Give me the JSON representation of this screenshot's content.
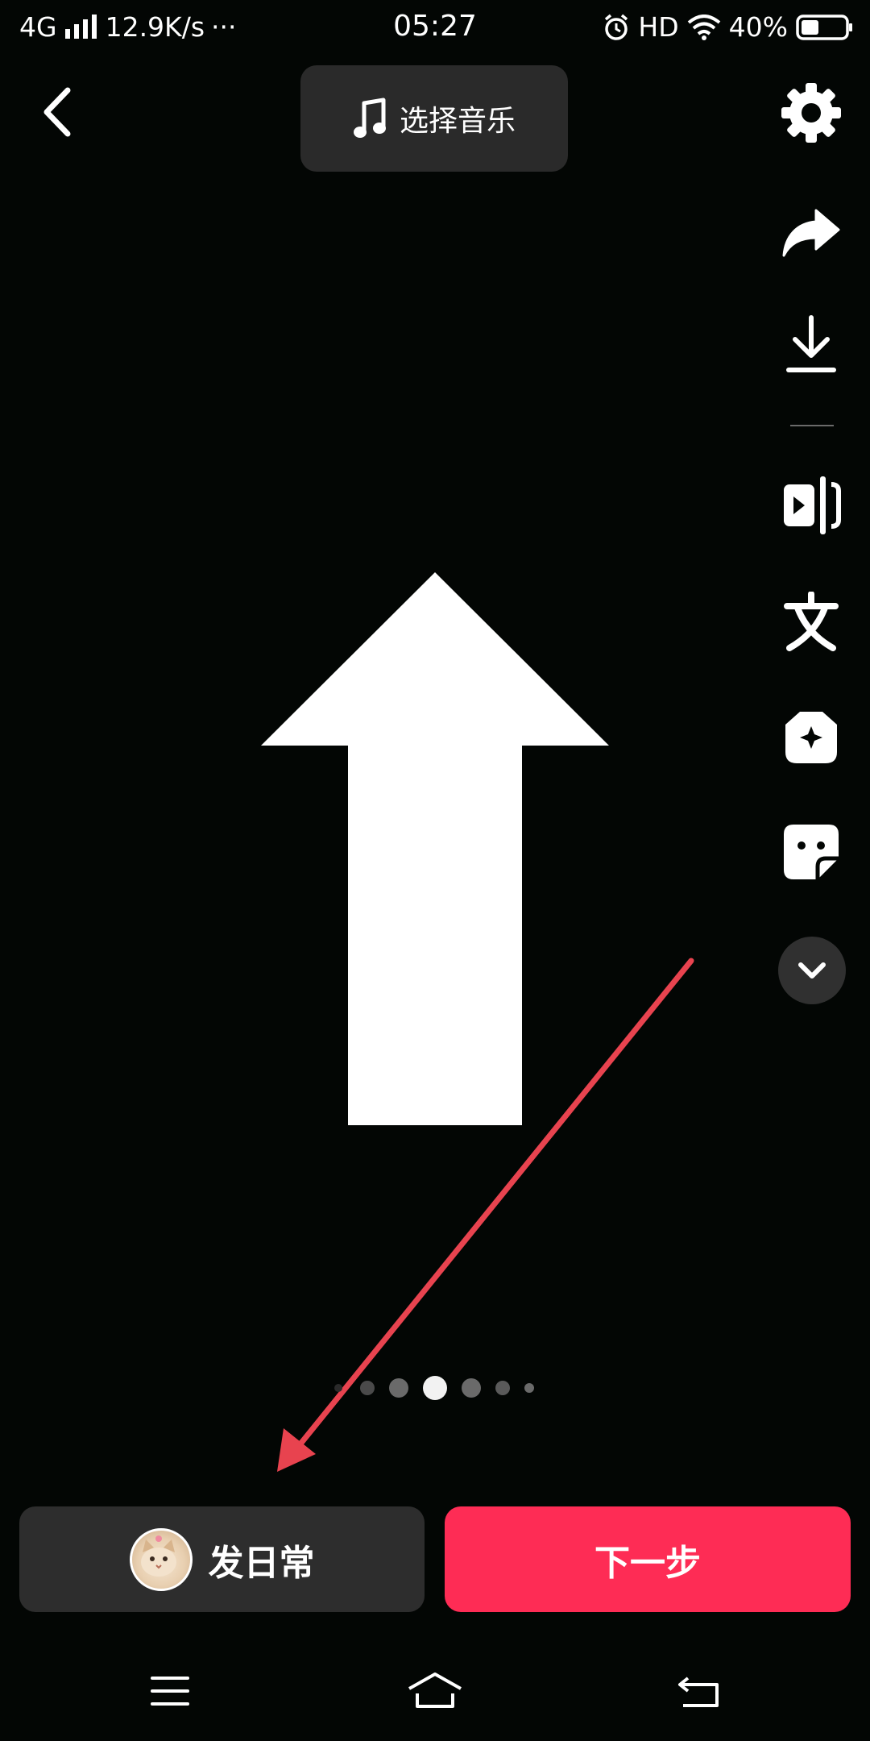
{
  "status_bar": {
    "network": "4G",
    "speed": "12.9K/s",
    "more": "···",
    "time": "05:27",
    "hd": "HD",
    "battery": "40%",
    "battery_level": 0.4
  },
  "top_bar": {
    "music_label": "选择音乐"
  },
  "side_tools": [
    "gear-icon",
    "share-icon",
    "download-icon",
    "clip-icon",
    "text-icon",
    "effects-icon",
    "sticker-icon",
    "chevron-down-icon"
  ],
  "pager": {
    "count": 7,
    "active": 3
  },
  "bottom": {
    "daily_label": "发日常",
    "next_label": "下一步"
  },
  "colors": {
    "accent": "#fe2c55",
    "annotation_arrow": "#e8434f",
    "background": "#030604"
  }
}
